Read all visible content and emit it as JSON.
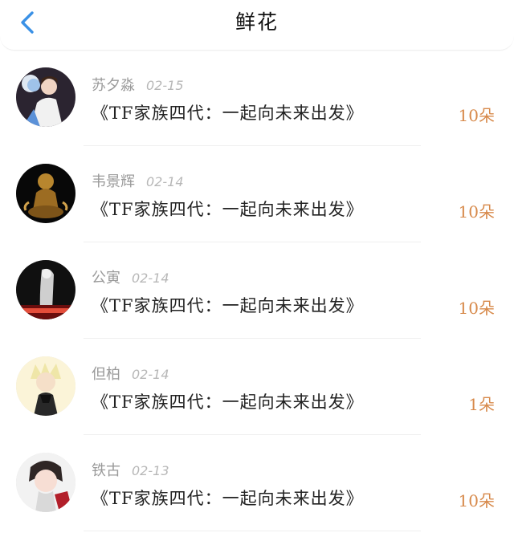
{
  "header": {
    "title": "鲜花"
  },
  "list": [
    {
      "name": "苏夕淼",
      "date": "02-15",
      "book": "《TF家族四代：一起向未来出发》",
      "count": "10朵"
    },
    {
      "name": "韦景辉",
      "date": "02-14",
      "book": "《TF家族四代：一起向未来出发》",
      "count": "10朵"
    },
    {
      "name": "公寅",
      "date": "02-14",
      "book": "《TF家族四代：一起向未来出发》",
      "count": "10朵"
    },
    {
      "name": "但柏",
      "date": "02-14",
      "book": "《TF家族四代：一起向未来出发》",
      "count": "1朵"
    },
    {
      "name": "铁古",
      "date": "02-13",
      "book": "《TF家族四代：一起向未来出发》",
      "count": "10朵"
    }
  ],
  "colors": {
    "accent_back": "#3a91e6",
    "count_orange": "#d7894a",
    "muted_text": "#9a9a9a",
    "date_text": "#b7b7b7",
    "divider": "#efefef"
  }
}
